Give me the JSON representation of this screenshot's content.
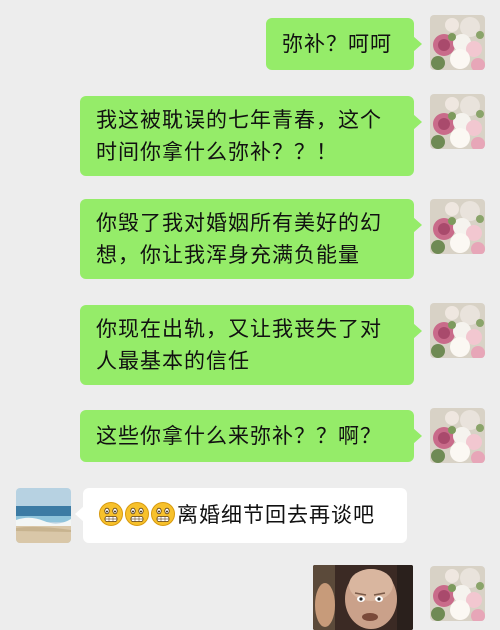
{
  "messages": [
    {
      "side": "right",
      "text": "弥补？呵呵"
    },
    {
      "side": "right",
      "text": "我这被耽误的七年青春，这个时间你拿什么弥补？？！"
    },
    {
      "side": "right",
      "text": "你毁了我对婚姻所有美好的幻想，你让我浑身充满负能量"
    },
    {
      "side": "right",
      "text": "你现在出轨，又让我丧失了对人最基本的信任"
    },
    {
      "side": "right",
      "text": "这些你拿什么来弥补？？啊？"
    },
    {
      "side": "left",
      "emoji": [
        "grimace-emoji",
        "grimace-emoji",
        "grimace-emoji"
      ],
      "text": "离婚细节回去再谈吧"
    },
    {
      "side": "right",
      "image": "meme-image-bald-man"
    }
  ],
  "colors": {
    "background": "#ededed",
    "outgoing_bubble": "#95ec69",
    "incoming_bubble": "#ffffff"
  }
}
